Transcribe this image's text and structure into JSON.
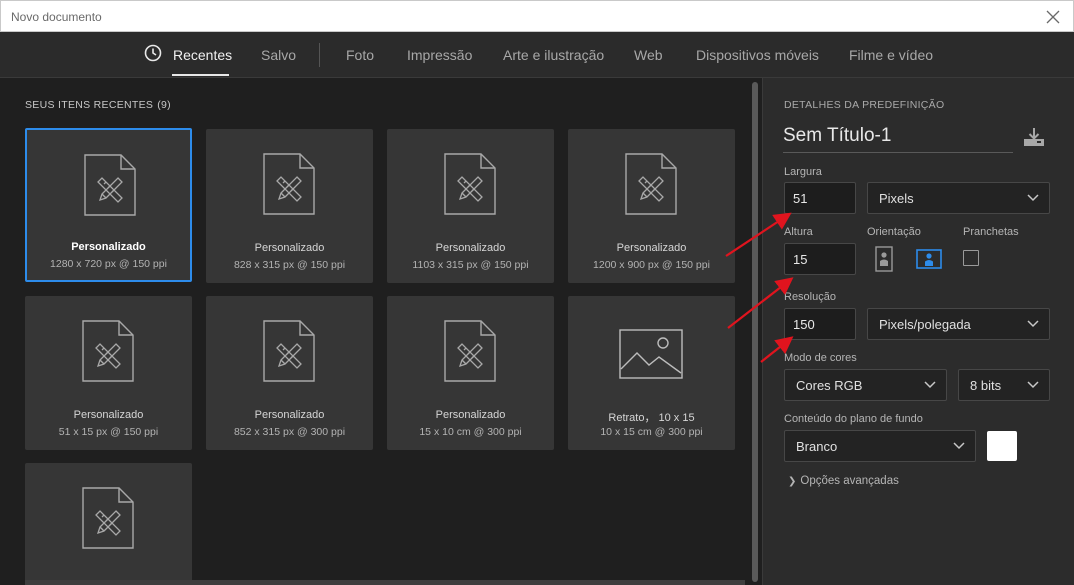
{
  "window": {
    "title": "Novo documento"
  },
  "tabs": [
    {
      "label": "Recentes",
      "active": true
    },
    {
      "label": "Salvo"
    },
    {
      "label": "Foto"
    },
    {
      "label": "Impressão"
    },
    {
      "label": "Arte e ilustração"
    },
    {
      "label": "Web"
    },
    {
      "label": "Dispositivos móveis"
    },
    {
      "label": "Filme e vídeo"
    }
  ],
  "recent": {
    "title": "SEUS ITENS RECENTES",
    "count": "(9)",
    "items": [
      {
        "name": "Personalizado",
        "size": "1280 x 720 px @ 150 ppi",
        "selected": true
      },
      {
        "name": "Personalizado",
        "size": "828 x 315 px @ 150 ppi"
      },
      {
        "name": "Personalizado",
        "size": "1103 x 315 px @ 150 ppi"
      },
      {
        "name": "Personalizado",
        "size": "1200 x 900 px @ 150 ppi"
      },
      {
        "name": "Personalizado",
        "size": "51 x 15 px @ 150 ppi"
      },
      {
        "name": "Personalizado",
        "size": "852 x 315 px @ 300 ppi"
      },
      {
        "name": "Personalizado",
        "size": "15 x 10 cm @ 300 ppi"
      },
      {
        "name": "Retrato， 10 x 15",
        "size": "10 x 15 cm @ 300 ppi",
        "icon": "image"
      },
      {
        "name": "",
        "size": ""
      }
    ]
  },
  "details": {
    "heading": "DETALHES DA PREDEFINIÇÃO",
    "doc_title": "Sem Título-1",
    "width_label": "Largura",
    "width_value": "51",
    "width_unit": "Pixels",
    "height_label": "Altura",
    "height_value": "15",
    "orientation_label": "Orientação",
    "artboards_label": "Pranchetas",
    "resolution_label": "Resolução",
    "resolution_value": "150",
    "resolution_unit": "Pixels/polegada",
    "color_mode_label": "Modo de cores",
    "color_mode": "Cores RGB",
    "bit_depth": "8 bits",
    "background_label": "Conteúdo do plano de fundo",
    "background": "Branco",
    "background_color": "#ffffff",
    "advanced": "Opções avançadas"
  },
  "colors": {
    "accent": "#2d8ceb",
    "annotation": "#e0141e"
  }
}
